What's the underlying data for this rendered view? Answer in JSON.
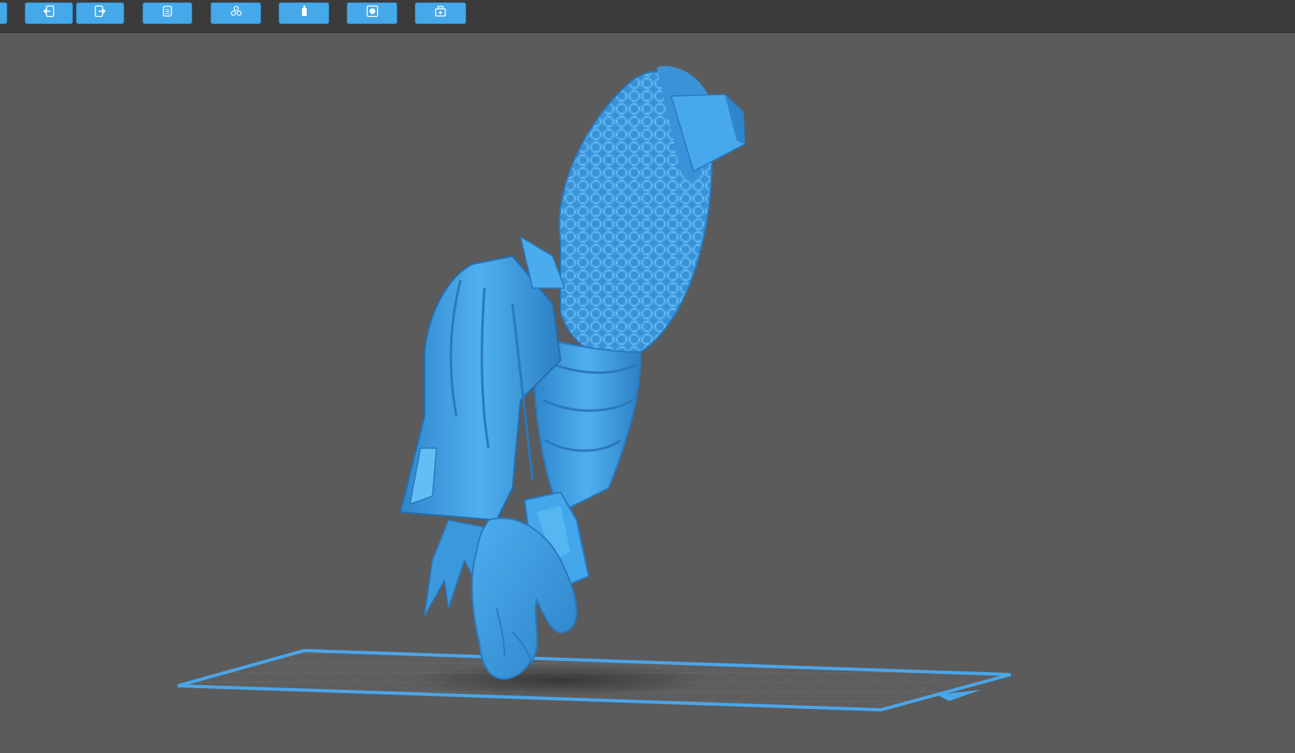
{
  "toolbar": {
    "buttons": [
      {
        "id": "partial",
        "icon": "panel-edge-icon"
      },
      {
        "id": "import",
        "icon": "import-arrow-icon"
      },
      {
        "id": "export",
        "icon": "export-arrow-icon"
      },
      {
        "id": "list",
        "icon": "object-list-icon"
      },
      {
        "id": "arrange",
        "icon": "auto-arrange-icon"
      },
      {
        "id": "supports",
        "icon": "supports-icon"
      },
      {
        "id": "hollow",
        "icon": "hollow-icon"
      },
      {
        "id": "add-print",
        "icon": "printer-add-icon"
      }
    ]
  },
  "colors": {
    "accent": "#45a8e8",
    "model": "#3f9ee6",
    "background": "#5b5b5b",
    "toolbar": "#3b3b3b",
    "build_plate": "#4aa6ea"
  },
  "viewport": {
    "model": "armored-gauntlet-model",
    "plate": "build-plate-grid"
  }
}
